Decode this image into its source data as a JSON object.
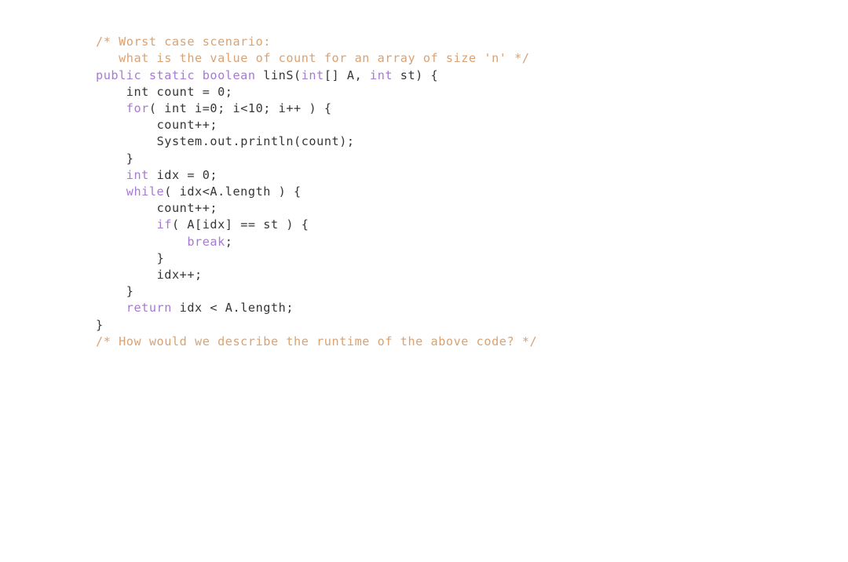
{
  "document": {
    "kind": "java-source-listing",
    "language": "Java",
    "background_color": "#ffffff"
  },
  "theme": {
    "comment_color": "#d9a273",
    "keyword_color": "#a779d6",
    "plain_color": "#363636",
    "background_color": "#ffffff"
  },
  "code": {
    "full_text": "/* Worst case scenario:\n   what is the value of count for an array of size 'n' */\npublic static boolean linS(int[] A, int st) {\n    int count = 0;\n    for( int i=0; i<10; i++ ) {\n        count++;\n        System.out.println(count);\n    }\n    int idx = 0;\n    while( idx<A.length ) {\n        count++;\n        if( A[idx] == st ) {\n            break;\n        }\n        idx++;\n    }\n    return idx < A.length;\n}\n/* How would we describe the runtime of the above code? */",
    "lines": [
      {
        "indent": "",
        "tokens": [
          {
            "type": "comment",
            "text": "/* Worst case scenario:"
          }
        ]
      },
      {
        "indent": "   ",
        "tokens": [
          {
            "type": "comment",
            "text": "what is the value of count for an array of size 'n' */"
          }
        ]
      },
      {
        "indent": "",
        "tokens": [
          {
            "type": "keyword",
            "text": "public static boolean "
          },
          {
            "type": "plain",
            "text": "linS("
          },
          {
            "type": "keyword",
            "text": "int"
          },
          {
            "type": "plain",
            "text": "[] A, "
          },
          {
            "type": "keyword",
            "text": "int"
          },
          {
            "type": "plain",
            "text": " st) {"
          }
        ]
      },
      {
        "indent": "    ",
        "tokens": [
          {
            "type": "plain",
            "text": "int count = 0;"
          }
        ]
      },
      {
        "indent": "    ",
        "tokens": [
          {
            "type": "keyword",
            "text": "for"
          },
          {
            "type": "plain",
            "text": "( int i=0; i<10; i++ ) {"
          }
        ]
      },
      {
        "indent": "        ",
        "tokens": [
          {
            "type": "plain",
            "text": "count++;"
          }
        ]
      },
      {
        "indent": "        ",
        "tokens": [
          {
            "type": "plain",
            "text": "System.out.println(count);"
          }
        ]
      },
      {
        "indent": "    ",
        "tokens": [
          {
            "type": "plain",
            "text": "}"
          }
        ]
      },
      {
        "indent": "    ",
        "tokens": [
          {
            "type": "keyword",
            "text": "int"
          },
          {
            "type": "plain",
            "text": " idx = 0;"
          }
        ]
      },
      {
        "indent": "    ",
        "tokens": [
          {
            "type": "keyword",
            "text": "while"
          },
          {
            "type": "plain",
            "text": "( idx<A.length ) {"
          }
        ]
      },
      {
        "indent": "        ",
        "tokens": [
          {
            "type": "plain",
            "text": "count++;"
          }
        ]
      },
      {
        "indent": "        ",
        "tokens": [
          {
            "type": "keyword",
            "text": "if"
          },
          {
            "type": "plain",
            "text": "( A[idx] == st ) {"
          }
        ]
      },
      {
        "indent": "            ",
        "tokens": [
          {
            "type": "keyword",
            "text": "break"
          },
          {
            "type": "plain",
            "text": ";"
          }
        ]
      },
      {
        "indent": "        ",
        "tokens": [
          {
            "type": "plain",
            "text": "}"
          }
        ]
      },
      {
        "indent": "        ",
        "tokens": [
          {
            "type": "plain",
            "text": "idx++;"
          }
        ]
      },
      {
        "indent": "    ",
        "tokens": [
          {
            "type": "plain",
            "text": "}"
          }
        ]
      },
      {
        "indent": "    ",
        "tokens": [
          {
            "type": "keyword",
            "text": "return"
          },
          {
            "type": "plain",
            "text": " idx < A.length;"
          }
        ]
      },
      {
        "indent": "",
        "tokens": [
          {
            "type": "plain",
            "text": "}"
          }
        ]
      },
      {
        "indent": "",
        "tokens": [
          {
            "type": "comment",
            "text": "/* How would we describe the runtime of the above code? */"
          }
        ]
      }
    ]
  }
}
